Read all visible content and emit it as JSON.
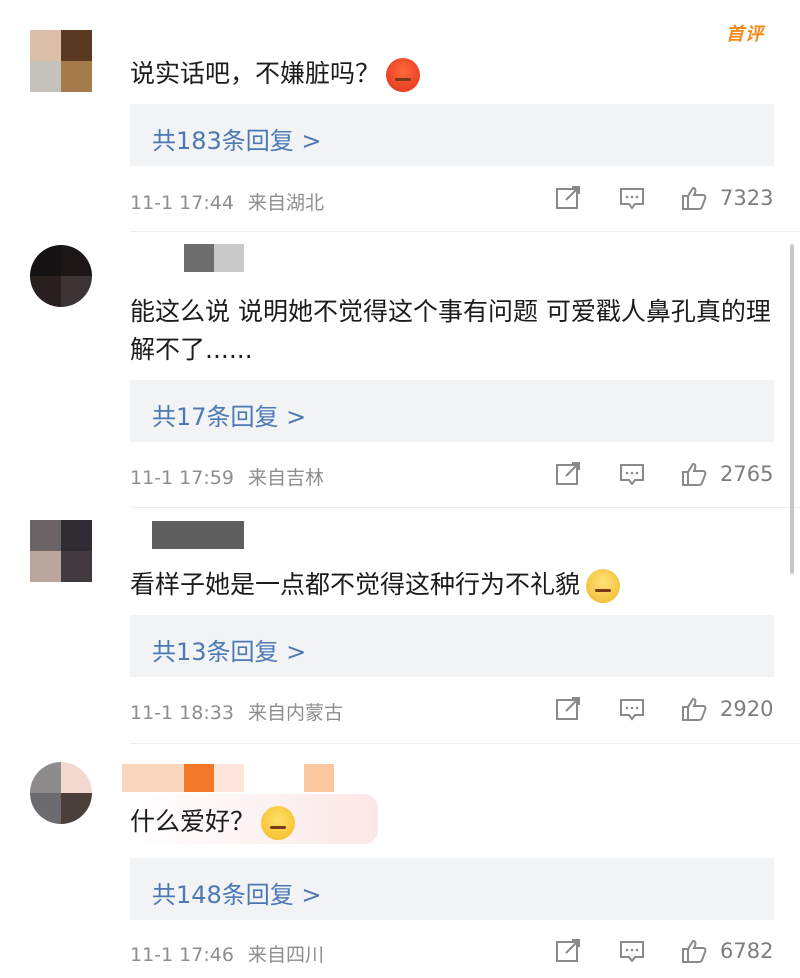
{
  "header": {
    "badge": "首评"
  },
  "comments": [
    {
      "text": "说实话吧，不嫌脏吗？",
      "emoji": "angry-face-emoji",
      "replies": "共183条回复 >",
      "time": "11-1 17:44",
      "location": "来自湖北",
      "likes": "7323",
      "avatar_colors": [
        "#dcbfa9",
        "#5a3a22",
        "#c4c2ba",
        "#a57b4c"
      ],
      "name_colors": [
        "#ffffff",
        "#ffffff"
      ]
    },
    {
      "text": "能这么说 说明她不觉得这个事有问题 可爱戳人鼻孔真的理解不了......",
      "emoji": "",
      "replies": "共17条回复 >",
      "time": "11-1 17:59",
      "location": "来自吉林",
      "likes": "2765",
      "avatar_colors": [
        "#141212",
        "#1d1616",
        "#2a1f1f",
        "#3d3436"
      ],
      "name_colors": [
        "#6e6e6e",
        "#c9c9c9"
      ]
    },
    {
      "text": "看样子她是一点都不觉得这种行为不礼貌",
      "emoji": "sleepy-face-emoji",
      "replies": "共13条回复 >",
      "time": "11-1 18:33",
      "location": "来自内蒙古",
      "likes": "2920",
      "avatar_colors": [
        "#6b6366",
        "#2f2c33",
        "#b9a59c",
        "#403a3f"
      ],
      "name_colors": [
        "#5f5f5f",
        "#5f5f5f"
      ]
    },
    {
      "text": "什么爱好？",
      "emoji": "sweat-face-emoji",
      "replies": "共148条回复 >",
      "time": "11-1 17:46",
      "location": "来自四川",
      "likes": "6782",
      "avatar_colors": [
        "#8d8b8c",
        "#f1d9d0",
        "#6b6b70",
        "#4a3f3a"
      ],
      "name_colors": [
        "#fbd6bf",
        "#f3782a"
      ]
    }
  ]
}
